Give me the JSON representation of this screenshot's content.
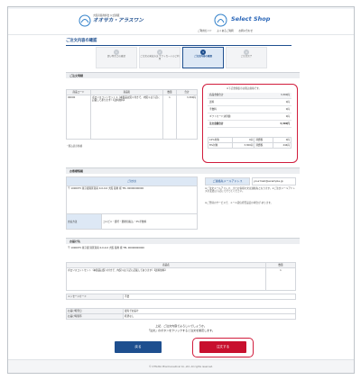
{
  "header": {
    "brand_tagline": "大阪府薬剤師会 公式通販",
    "brand_name": "オオサカ・アラスワン",
    "shop_name": "Select Shop",
    "nav_links": [
      "ご利用ガイド",
      "よくあるご質問",
      "お問い合わせ"
    ],
    "colors": {
      "brand_blue": "#1e4f8f",
      "accent_red": "#c8102e"
    }
  },
  "page_title": "ご注文内容の確認",
  "steps": [
    {
      "num": "1",
      "label": "買い物カゴの確認"
    },
    {
      "num": "2",
      "label": "ご注文の発送方法 ギフトカードのご利用"
    },
    {
      "num": "3",
      "label": "ご注文内容の確認"
    },
    {
      "num": "4",
      "label": "ご注文完了"
    }
  ],
  "order_details": {
    "heading": "ご注文明細",
    "columns": [
      "商品コード",
      "商品名",
      "数量",
      "合計"
    ],
    "rows": [
      {
        "code": "00000",
        "name": "ボロリスコットセット 1（本製品は熨斗付きで、内熨斗は下記に記載してあります）【送料無料】",
        "qty": "1",
        "total": "3,300円"
      }
    ],
    "note": "・税込表示価格"
  },
  "summary": {
    "note": "※下記金額表示は税込価格です。",
    "rows": [
      {
        "label": "商品金額合計",
        "value": "3,300円"
      },
      {
        "label": "送料",
        "value": "0円"
      },
      {
        "label": "手数料",
        "value": "0円"
      },
      {
        "label": "ギフトカード決済額",
        "value": "0円"
      },
      {
        "label": "注文金額合計",
        "value": "3,300円"
      }
    ],
    "tax_rows": [
      {
        "rate": "10%対象",
        "amount": "0円",
        "tax_label": "消費税",
        "tax": "0円"
      },
      {
        "rate": "8%対象",
        "amount": "3,300円",
        "tax_label": "消費税",
        "tax": "244円"
      }
    ]
  },
  "customer": {
    "heading": "お客様情報",
    "name_label": "ご注文主",
    "address": "〒 1000075 東京都港区港南 0-0-0-0 大阪 薬剤 様 TEL 00000000000",
    "payment_label": "支払方法",
    "payment_value": "コンビニ・郵行・郵便局振込・3%手数料",
    "email_label": "ご連絡先メールアドレス",
    "email_value": "yourmail@example.jp",
    "email_note": "※ご注文メールアドレス、またお客様の文は連絡先となります。※ご注文メールアドレスの変更は下記にて行ってください。",
    "email_note2": "※ご登録のサービスで、メール受信拒否設定の場合が あります。"
  },
  "delivery": {
    "heading": "お届け先",
    "address": "〒 1000075 東京都 港区港南 0-0-0-0 大阪 薬剤 様 TEL 00000000000",
    "columns": [
      "商品名",
      "数量"
    ],
    "item_name": "ボロリスコットセット（本製品は熨斗付きで、内熨斗は下記に記載してあります）【送料無料】",
    "item_qty": "1",
    "message_label": "メッセージカード",
    "message_value": "不要",
    "date_label": "お届け希望日",
    "date_value": "最短でお届け",
    "time_label": "お届け時間帯",
    "time_value": "希望なし"
  },
  "confirm": {
    "line1": "上記、ご注文内容でよろしいでしょうか。",
    "line2": "「注文」のボタンをクリックすると注文を確定します。",
    "back_label": "戻る",
    "order_label": "注文する"
  },
  "footer": {
    "copyright": "© OTSUKA Pharmaceutical Co.,Ltd. All rights reserved."
  }
}
